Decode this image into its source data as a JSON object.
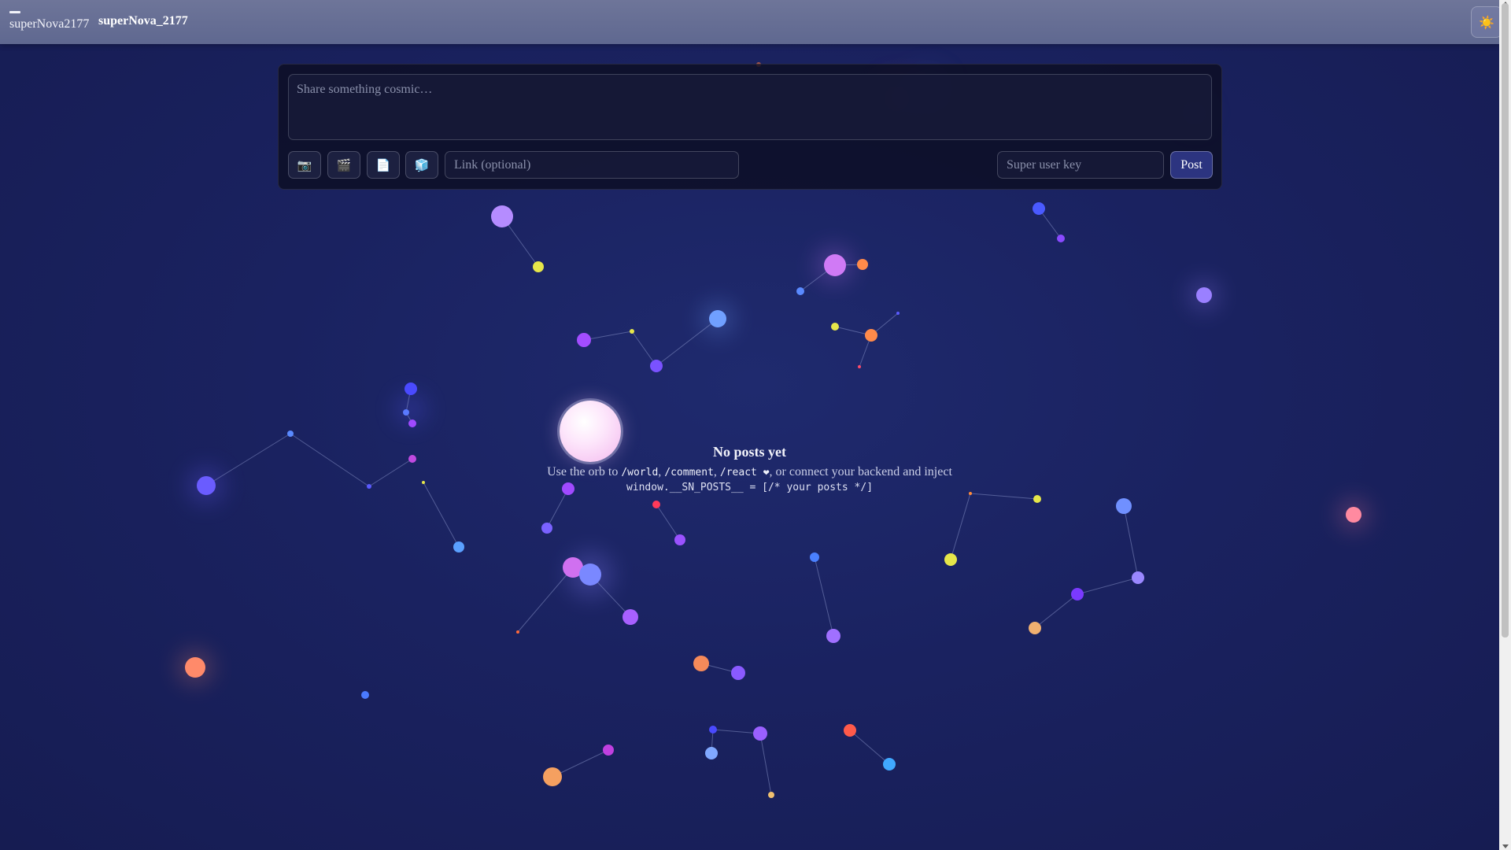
{
  "header": {
    "brand": "superNova2177",
    "title": "superNova_2177",
    "theme_icon": "sun-icon"
  },
  "composer": {
    "placeholder": "Share something cosmic…",
    "tools": [
      {
        "name": "camera-icon",
        "glyph": "📷"
      },
      {
        "name": "clapper-icon",
        "glyph": "🎬"
      },
      {
        "name": "document-icon",
        "glyph": "📄"
      },
      {
        "name": "cube-icon",
        "glyph": "🧊"
      }
    ],
    "link_placeholder": "Link (optional)",
    "key_placeholder": "Super user key",
    "post_label": "Post"
  },
  "empty_state": {
    "title": "No posts yet",
    "line1_prefix": "Use the orb to",
    "commands": [
      "/world",
      "/comment",
      "/react ❤"
    ],
    "line1_suffix": ", or connect your backend and inject",
    "line2": "window.__SN_POSTS__ = [/* your posts */]"
  },
  "colors": {
    "accent": "#2c3480",
    "background": "#1a2260",
    "topbar": "#646c93"
  }
}
